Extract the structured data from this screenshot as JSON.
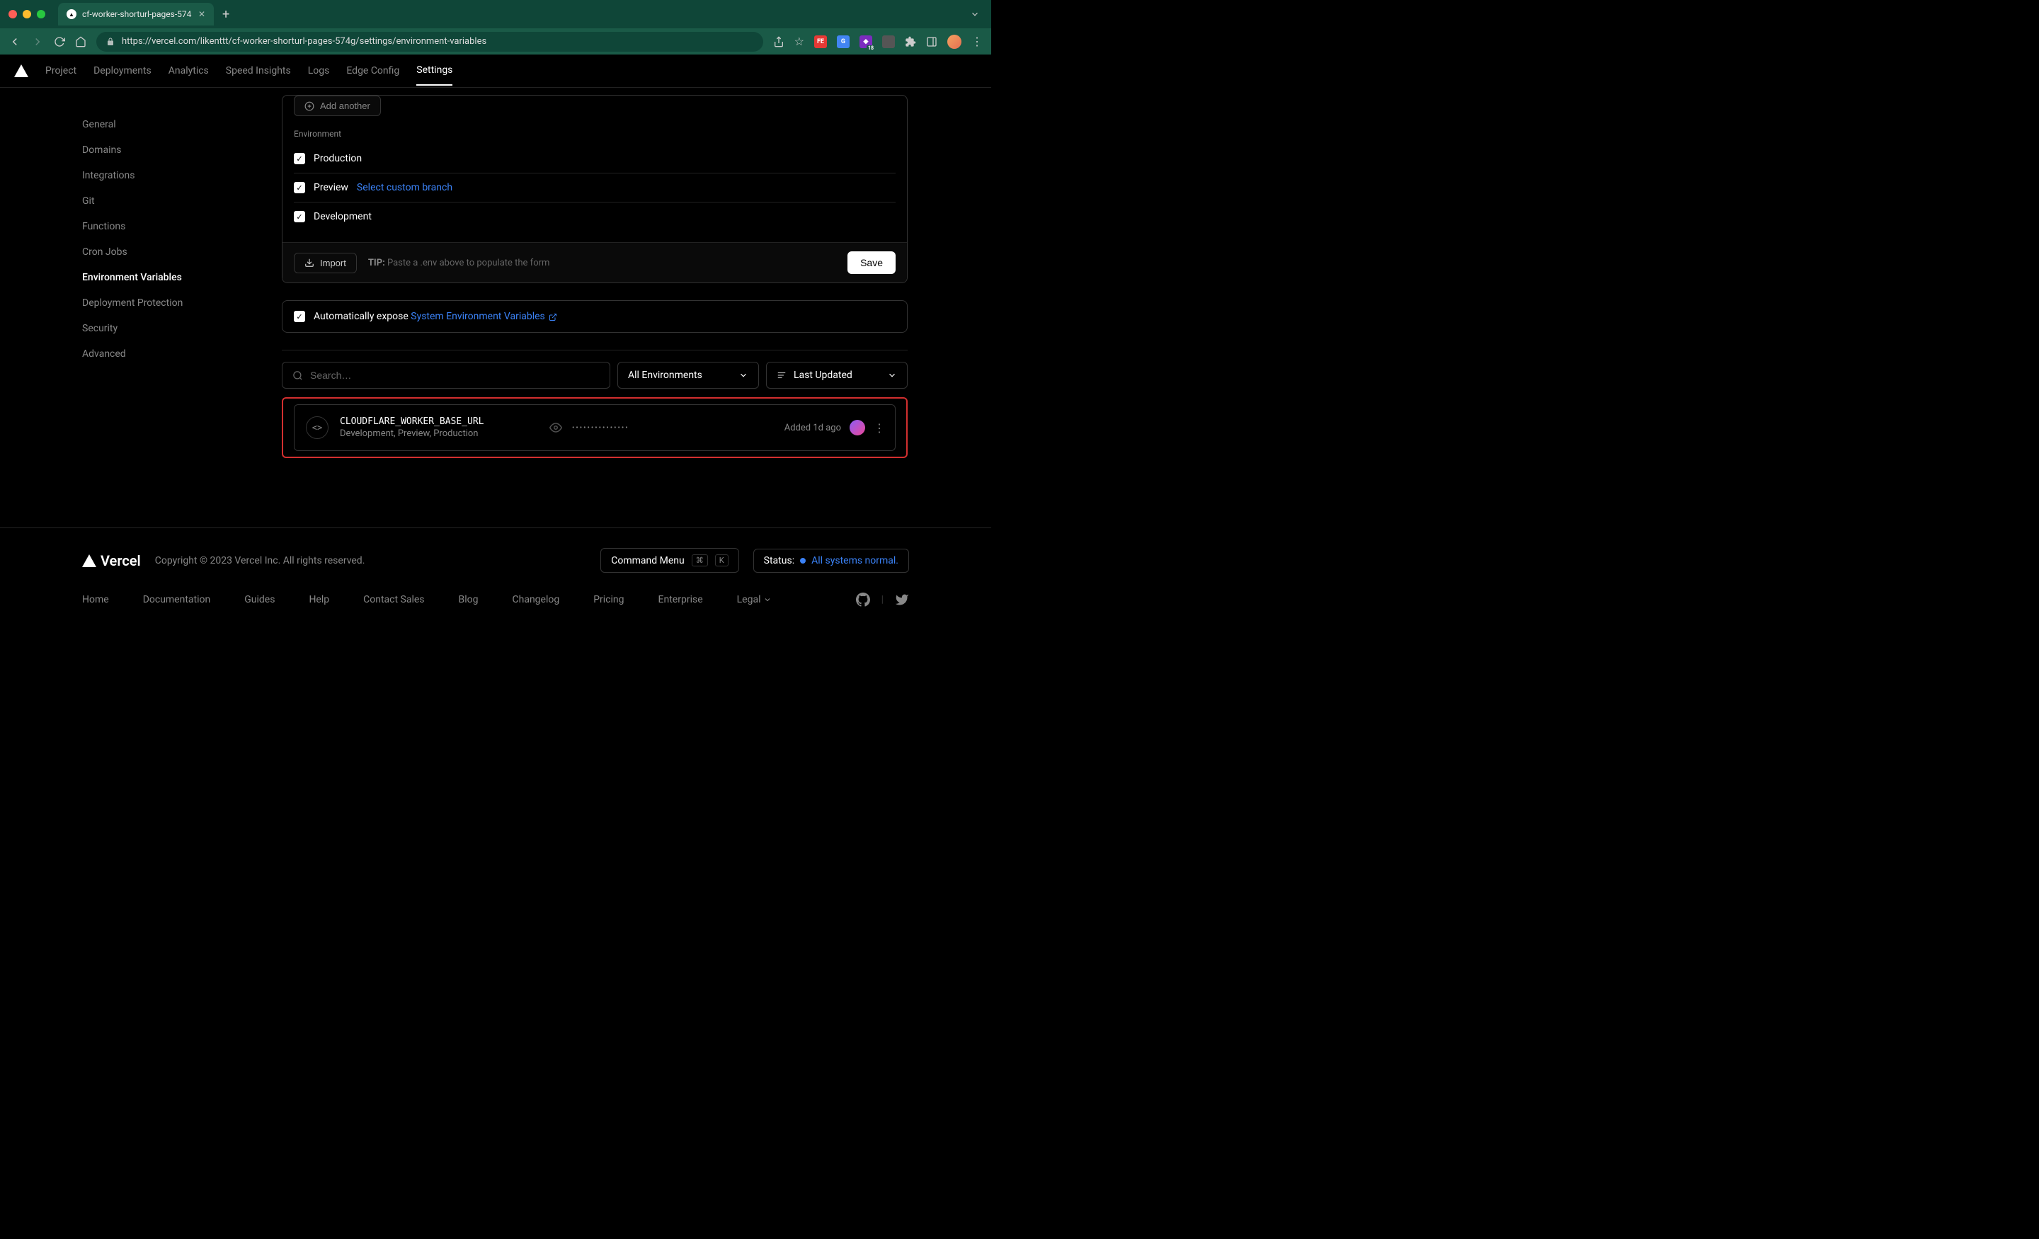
{
  "browser": {
    "tab_title": "cf-worker-shorturl-pages-574",
    "url": "https://vercel.com/likenttt/cf-worker-shorturl-pages-574g/settings/environment-variables",
    "ext_badge": "18"
  },
  "nav": {
    "items": [
      "Project",
      "Deployments",
      "Analytics",
      "Speed Insights",
      "Logs",
      "Edge Config",
      "Settings"
    ],
    "active": "Settings"
  },
  "sidebar": {
    "items": [
      "General",
      "Domains",
      "Integrations",
      "Git",
      "Functions",
      "Cron Jobs",
      "Environment Variables",
      "Deployment Protection",
      "Security",
      "Advanced"
    ],
    "active": "Environment Variables"
  },
  "panel": {
    "add_another": "Add another",
    "env_label": "Environment",
    "production": "Production",
    "preview": "Preview",
    "select_branch": "Select custom branch",
    "development": "Development",
    "import": "Import",
    "tip_label": "TIP:",
    "tip_text": " Paste a .env above to populate the form",
    "save": "Save"
  },
  "expose": {
    "text": "Automatically expose ",
    "link": "System Environment Variables"
  },
  "filters": {
    "search_placeholder": "Search…",
    "env_filter": "All Environments",
    "sort": "Last Updated"
  },
  "variable": {
    "name": "CLOUDFLARE_WORKER_BASE_URL",
    "envs": "Development, Preview, Production",
    "masked": "•••••••••••••••",
    "added": "Added 1d ago"
  },
  "footer": {
    "brand": "Vercel",
    "copyright": "Copyright © 2023 Vercel Inc. All rights reserved.",
    "cmd_menu": "Command Menu",
    "kbd1": "⌘",
    "kbd2": "K",
    "status_label": "Status:",
    "status_text": "All systems normal.",
    "links": [
      "Home",
      "Documentation",
      "Guides",
      "Help",
      "Contact Sales",
      "Blog",
      "Changelog",
      "Pricing",
      "Enterprise",
      "Legal"
    ]
  }
}
